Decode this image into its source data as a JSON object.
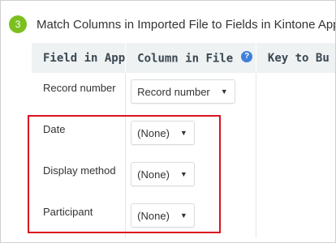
{
  "step": {
    "number": "3",
    "title": "Match Columns in Imported File to Fields in Kintone App"
  },
  "table": {
    "headers": {
      "field_in_app": "Field in App",
      "column_in_file": "Column in File",
      "key_to_bulk": "Key to Bu"
    },
    "help_icon_glyph": "?",
    "rows": [
      {
        "field": "Record number",
        "column_value": "Record number"
      },
      {
        "field": "Date",
        "column_value": "(None)"
      },
      {
        "field": "Display method",
        "column_value": "(None)"
      },
      {
        "field": "Participant",
        "column_value": "(None)"
      }
    ]
  },
  "icons": {
    "help": "help-icon",
    "dropdown": "triangle-down-icon",
    "dropdown_glyph": "▼"
  },
  "colors": {
    "step_badge": "#7cc01f",
    "header_bg": "#eef2f3",
    "help_icon": "#3f7fd9",
    "highlight": "#d9131e"
  }
}
